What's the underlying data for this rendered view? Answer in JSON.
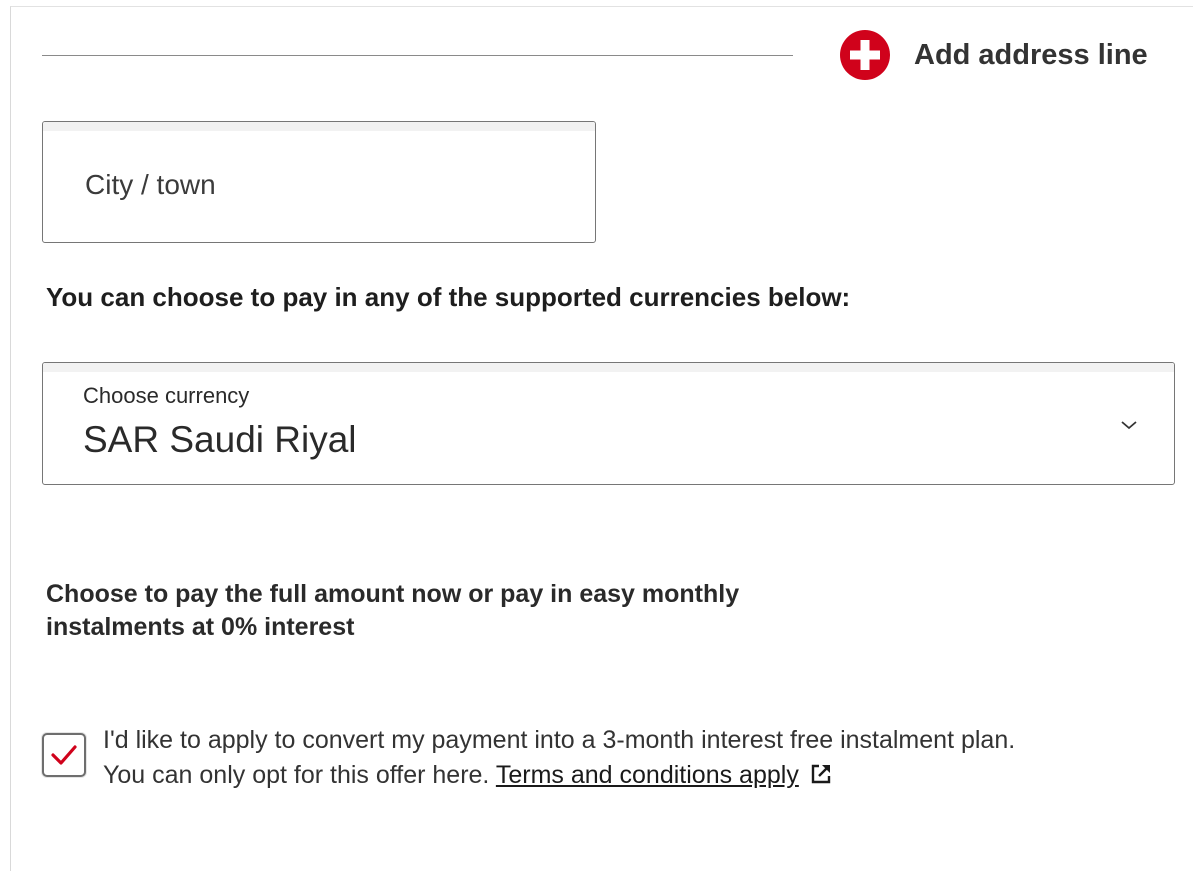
{
  "address": {
    "add_line_label": "Add address line",
    "add_icon": "plus-circle-icon",
    "accent_color": "#d0021b"
  },
  "city": {
    "placeholder": "City / town",
    "value": ""
  },
  "currency": {
    "heading": "You can choose to pay in any of the supported currencies below:",
    "select_label": "Choose currency",
    "selected_value": "SAR Saudi Riyal",
    "chevron_icon": "chevron-down-icon"
  },
  "instalments": {
    "description_line1": "Choose to pay the full amount now or pay in easy monthly",
    "description_line2": "instalments at 0% interest",
    "checkbox_checked": true,
    "check_color": "#d0021b",
    "consent_line1": "I'd like to apply to convert my payment into a 3-month interest free instalment plan.",
    "consent_line2": "You can only opt for this offer here.",
    "terms_link": "Terms and conditions apply",
    "external_icon": "external-link-icon"
  }
}
